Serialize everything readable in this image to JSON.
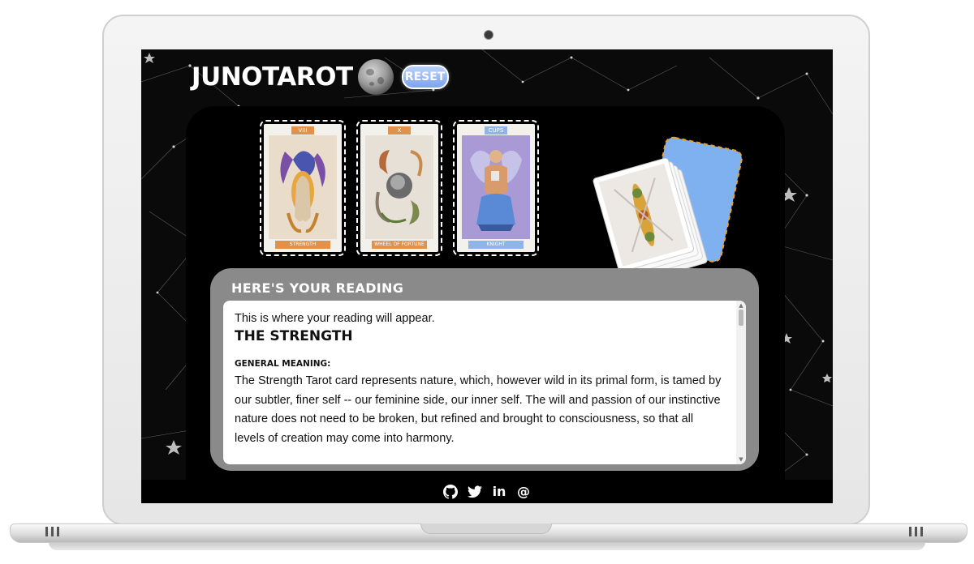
{
  "app": {
    "brand": "JUNOTAROT",
    "reset_label": "RESET"
  },
  "cards": [
    {
      "numeral": "VIII",
      "name": "STRENGTH",
      "accent": "#e2914a"
    },
    {
      "numeral": "X",
      "name": "WHEEL OF FORTUNE",
      "accent": "#e2914a"
    },
    {
      "numeral": "CUPS",
      "name": "KNIGHT",
      "accent": "#8fb4e6"
    }
  ],
  "reading": {
    "heading": "HERE'S YOUR READING",
    "intro": "This is where your reading will appear.",
    "card_title": "THE STRENGTH",
    "section_label": "GENERAL MEANING:",
    "meaning": "The Strength Tarot card represents nature, which, however wild in its primal form, is tamed by our subtler, finer self -- our feminine side, our inner self. The will and passion of our instinctive nature does not need to be broken, but refined and brought to consciousness, so that all levels of creation may come into harmony."
  },
  "footer": {
    "icons": [
      "github-icon",
      "twitter-icon",
      "linkedin-icon",
      "email-icon"
    ],
    "email_glyph": "@",
    "linkedin_glyph": "in"
  },
  "colors": {
    "screen_bg": "#0a0a0a",
    "reading_panel": "#8a8a8a",
    "reset_button": "#7da3ee",
    "card_accent_orange": "#e2914a",
    "card_accent_blue": "#8fb4e6",
    "deck_highlight": "#f0a028"
  }
}
